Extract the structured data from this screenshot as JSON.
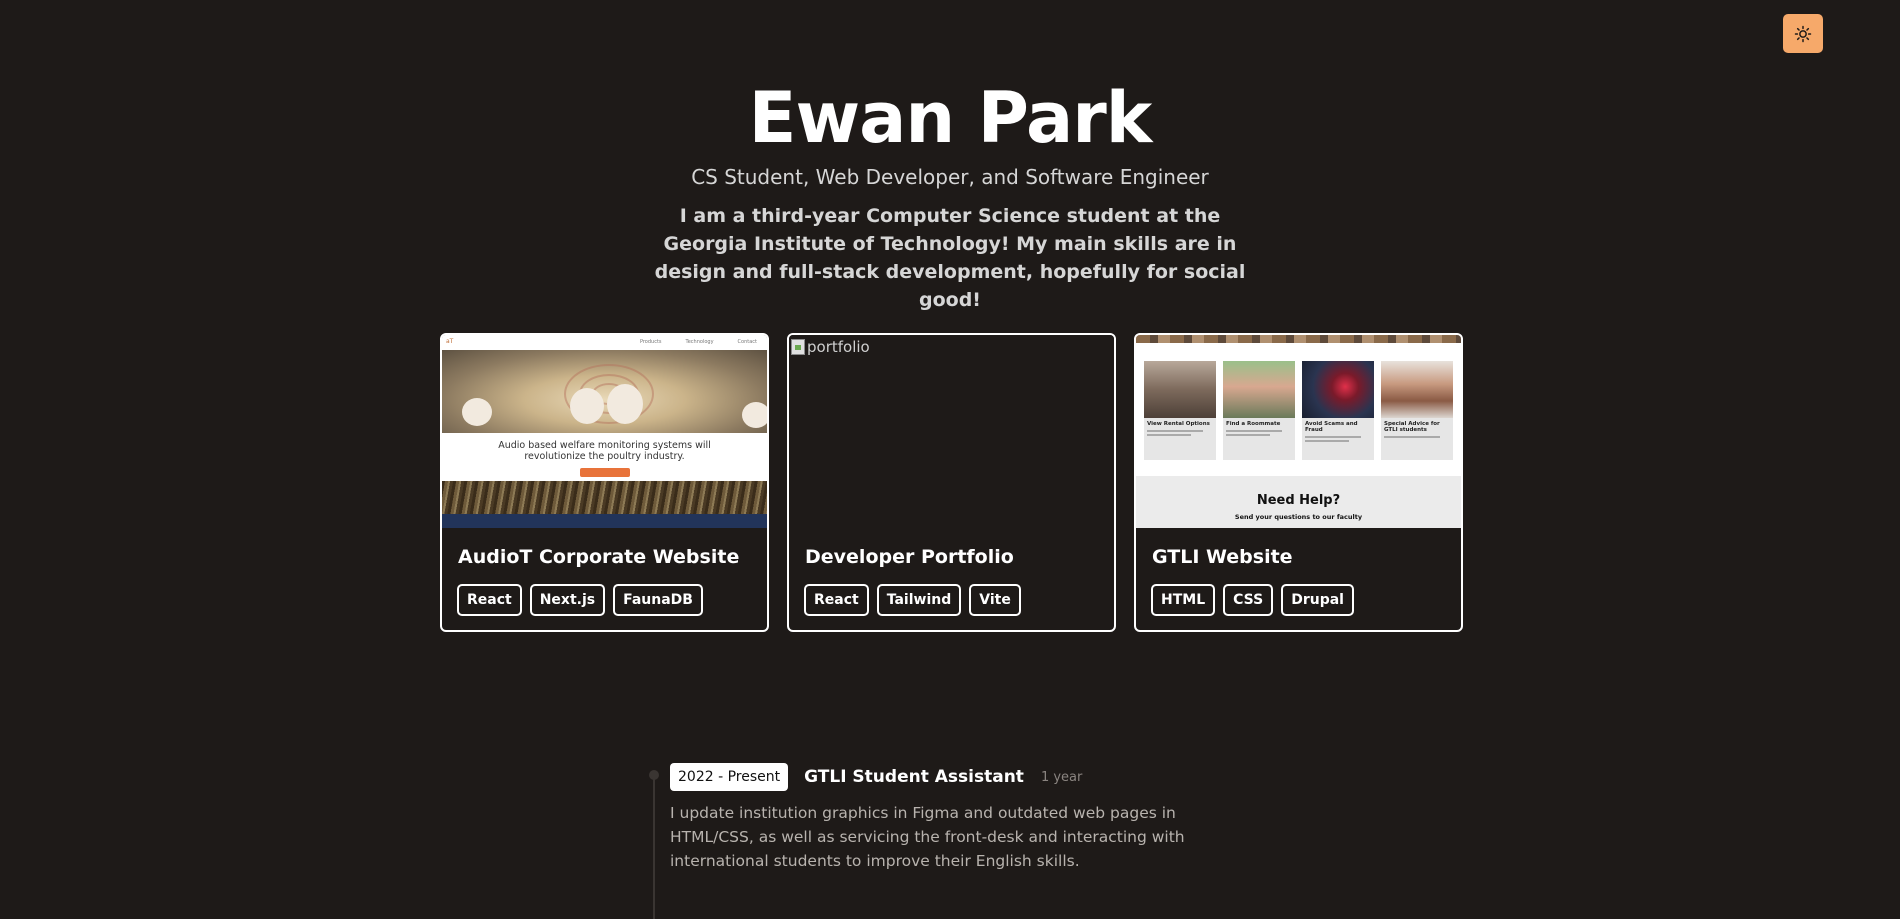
{
  "theme_toggle": {
    "icon": "sun-icon",
    "color": "#f6a96a"
  },
  "hero": {
    "name": "Ewan Park",
    "subtitle": "CS Student, Web Developer, and Software Engineer",
    "bio": "I am a third-year Computer Science student at the Georgia Institute of Technology! My main skills are in design and full-stack development, hopefully for social good!"
  },
  "projects": [
    {
      "title": "AudioT Corporate Website",
      "tags": [
        "React",
        "Next.js",
        "FaunaDB"
      ],
      "thumb": {
        "logo": "aT",
        "nav_links": [
          "Products",
          "Technology",
          "Contact"
        ],
        "headline": "Audio based welfare monitoring systems will revolutionize the poultry industry.",
        "button": "Learn more"
      }
    },
    {
      "title": "Developer Portfolio",
      "tags": [
        "React",
        "Tailwind",
        "Vite"
      ],
      "thumb": {
        "alt": "portfolio"
      }
    },
    {
      "title": "GTLI Website",
      "tags": [
        "HTML",
        "CSS",
        "Drupal"
      ],
      "thumb": {
        "tiles": [
          "View Rental Options",
          "Find a Roommate",
          "Avoid Scams and Fraud",
          "Special Advice for GTLI students"
        ],
        "help_title": "Need Help?",
        "help_sub": "Send your questions to our faculty"
      }
    }
  ],
  "experience": [
    {
      "date": "2022 - Present",
      "role": "GTLI Student Assistant",
      "duration": "1 year",
      "description": "I update institution graphics in Figma and outdated web pages in HTML/CSS, as well as servicing the front-desk and interacting with international students to improve their English skills."
    }
  ]
}
